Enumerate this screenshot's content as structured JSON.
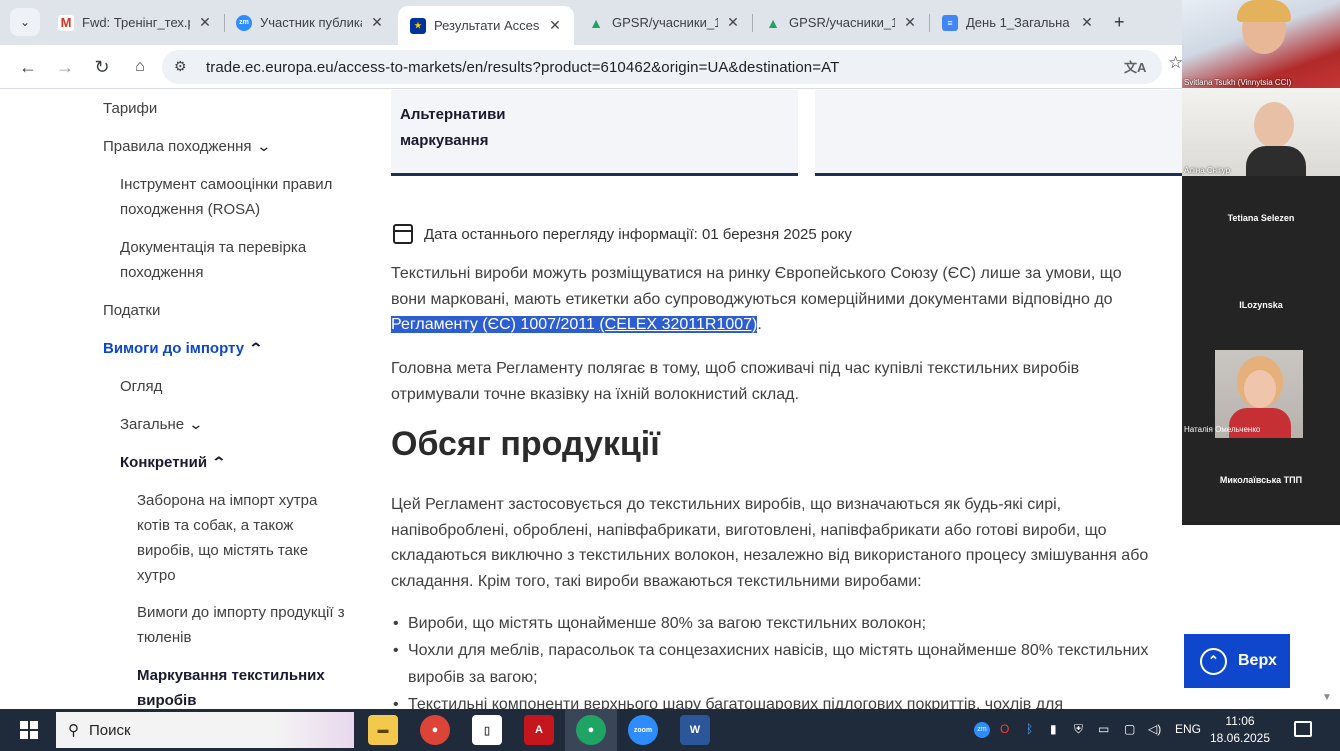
{
  "browser": {
    "tabs": [
      {
        "title": "Fwd: Тренінг_тех.р",
        "icon": "gmail-icon",
        "color": "#d93025"
      },
      {
        "title": "Участник публика",
        "icon": "zoom-icon",
        "color": "#2d8cff"
      },
      {
        "title": "Результати Access",
        "icon": "eu-flag-icon",
        "color": "#003399"
      },
      {
        "title": "GPSR/учасники_1",
        "icon": "google-drive-icon",
        "color": "#1fa463"
      },
      {
        "title": "GPSR/учасники_1",
        "icon": "google-drive-icon",
        "color": "#1fa463"
      },
      {
        "title": "День 1_Загальна",
        "icon": "google-docs-icon",
        "color": "#4285f4"
      }
    ],
    "new_tab": "+",
    "url": "trade.ec.europa.eu/access-to-markets/en/results?product=610462&origin=UA&destination=AT"
  },
  "sidebar": {
    "items": [
      {
        "label": "Тарифи"
      },
      {
        "label": "Правила походження"
      },
      {
        "label": "Інструмент самооцінки правил походження (ROSA)"
      },
      {
        "label": "Документація та перевірка походження"
      },
      {
        "label": "Податки"
      },
      {
        "label": "Вимоги до імпорту"
      },
      {
        "label": "Огляд"
      },
      {
        "label": "Загальне"
      },
      {
        "label": "Конкретний"
      },
      {
        "label": "Заборона на імпорт хутра котів та собак, а також виробів, що містять таке хутро"
      },
      {
        "label": "Вимоги до імпорту продукції з тюленів"
      },
      {
        "label": "Маркування текстильних виробів"
      }
    ]
  },
  "main": {
    "cards": [
      {
        "title": "Альтернативи маркування"
      },
      {
        "title": ""
      }
    ],
    "date_label": "Дата останнього перегляду інформації: 01 березня 2025 року",
    "intro_before": "Текстильні вироби можуть розміщуватися на ринку Європейського Союзу (ЄС) лише за умови, що вони марковані, мають етикетки або супроводжуються комерційними документами відповідно до ",
    "intro_link1": "Регламенту (ЄС) 1007/2011",
    "intro_link2": "(CELEX 32011R1007)",
    "intro_after": ".",
    "goal": "Головна мета Регламенту полягає в тому, щоб споживачі під час купівлі текстильних виробів отримували точне вказівку на їхній волокнистий склад.",
    "heading": "Обсяг продукції",
    "scope": "Цей Регламент застосовується до текстильних виробів, що визначаються як будь-які сирі, напівоброблені, оброблені, напівфабрикати, виготовлені, напівфабрикати або готові вироби, що складаються виключно з текстильних волокон, незалежно від використаного процесу змішування або складання. Крім того, такі вироби вважаються текстильними виробами:",
    "bullets": [
      "Вироби, що містять щонайменше 80% за вагою текстильних волокон;",
      "Чохли для меблів, парасольок та сонцезахисних навісів, що містять щонайменше 80% текстильних виробів за вагою;",
      "Текстильні компоненти верхнього шару багатошарових підлогових покриттів, чохлів для"
    ],
    "back_to_top": "Верх"
  },
  "video_panel": {
    "participants": [
      "Svitlana Tsukh (Vinnytsia CCI)",
      "Аліна Снігур",
      "Tetiana Selezen",
      "ILozynska",
      "Наталія Омельченко",
      "Миколаївська ТПП"
    ]
  },
  "taskbar": {
    "search_placeholder": "Поиск",
    "language": "ENG",
    "time": "11:06",
    "date": "18.06.2025",
    "apps": [
      "file-explorer-icon",
      "chrome-icon",
      "notepad-icon",
      "acrobat-icon",
      "chrome-icon",
      "zoom-icon",
      "word-icon"
    ]
  }
}
